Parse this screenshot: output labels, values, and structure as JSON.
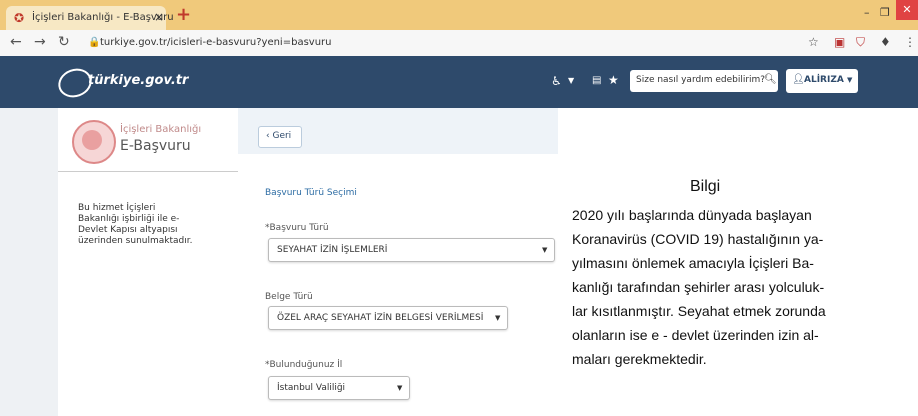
{
  "browser": {
    "tab_title": "İçişleri Bakanlığı - E-Başvuru",
    "tab_close": "×",
    "new_tab": "+",
    "url": "turkiye.gov.tr/icisleri-e-basvuru?yeni=basvuru",
    "window_minimize": "–",
    "window_maximize": "❐",
    "window_close": "✕"
  },
  "site_header": {
    "logo_text": "türkiye.gov.tr",
    "search_placeholder": "Size nasıl yardım edebilirim?",
    "user_name": "ALİRIZA"
  },
  "left_panel": {
    "agency_name": "İçişleri Bakanlığı",
    "app_name": "E-Başvuru",
    "note": "Bu hizmet İçişleri Bakanlığı işbirliği ile e-Devlet Kapısı altyapısı üzerinden sunulmaktadır."
  },
  "main": {
    "back_button": "Geri",
    "section_title": "Başvuru Türü Seçimi",
    "fields": [
      {
        "label": "*Başvuru Türü",
        "value": "SEYAHAT İZİN İŞLEMLERİ"
      },
      {
        "label": "Belge Türü",
        "value": "ÖZEL ARAÇ SEYAHAT İZİN BELGESİ VERİLMESİ"
      },
      {
        "label": "*Bulunduğunuz İl",
        "value": "İstanbul Valiliği"
      }
    ]
  },
  "info_box": {
    "title": "Bilgi",
    "lines": [
      "2020 yılı başlarında dünyada başlayan",
      "Koranavirüs (COVID 19) hastalığının ya-",
      "yılmasını önlemek amacıyla İçişleri Ba-",
      "kanlığı tarafından şehirler arası yolculuk-",
      "lar kısıtlanmıştır. Seyahat etmek zorunda",
      "olanların ise e - devlet üzerinden izin al-",
      "maları gerekmektedir."
    ]
  },
  "colors": {
    "header_bg": "#2e4a6b",
    "tabbar_bg": "#f0c97b",
    "accent_link": "#2e6da4"
  }
}
